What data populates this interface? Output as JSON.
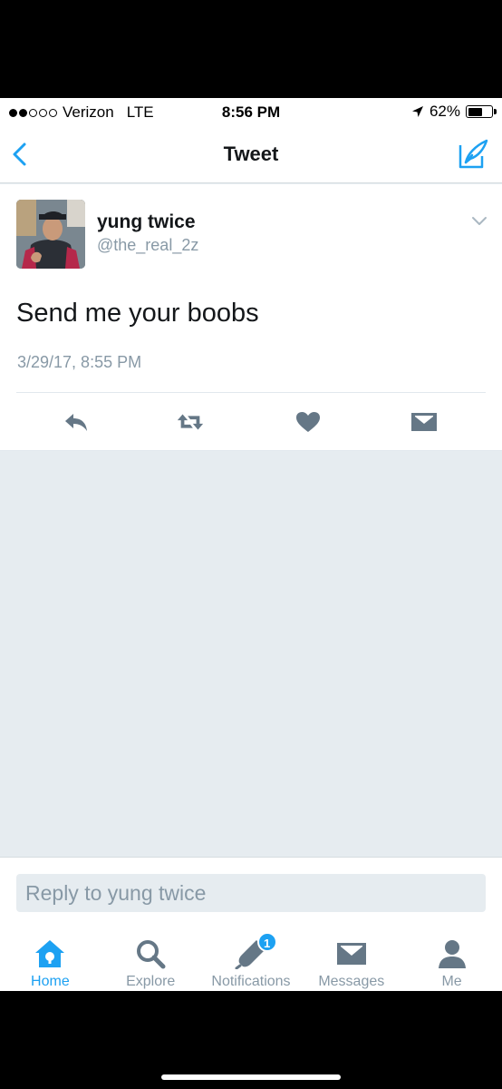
{
  "status_bar": {
    "carrier": "Verizon",
    "network": "LTE",
    "time": "8:56 PM",
    "battery": "62%",
    "battery_level": 0.62
  },
  "nav": {
    "title": "Tweet"
  },
  "tweet": {
    "author_name": "yung twice",
    "author_handle": "@the_real_2z",
    "text": "Send me your boobs",
    "timestamp": "3/29/17, 8:55 PM"
  },
  "reply": {
    "placeholder": "Reply to yung twice"
  },
  "tabs": [
    {
      "label": "Home",
      "icon": "home-icon",
      "active": true
    },
    {
      "label": "Explore",
      "icon": "search-icon"
    },
    {
      "label": "Notifications",
      "icon": "bell-icon",
      "badge": "1"
    },
    {
      "label": "Messages",
      "icon": "envelope-icon"
    },
    {
      "label": "Me",
      "icon": "person-icon"
    }
  ],
  "colors": {
    "accent": "#1da1f2",
    "icon_gray": "#657786",
    "secondary_text": "#8899a6",
    "background": "#e6ecf0"
  }
}
